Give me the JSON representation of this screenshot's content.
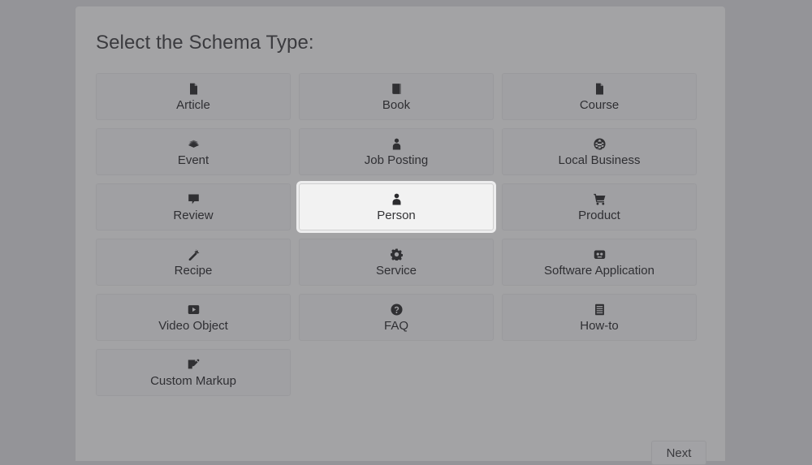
{
  "page": {
    "background_color": "#949498",
    "panel_color": "#a3a3a5"
  },
  "panel": {
    "title": "Select the Schema Type:"
  },
  "schema_types": {
    "selected": "Person",
    "items": [
      {
        "label": "Article",
        "icon": "file-icon",
        "selected": false
      },
      {
        "label": "Book",
        "icon": "book-icon",
        "selected": false
      },
      {
        "label": "Course",
        "icon": "file-icon",
        "selected": false
      },
      {
        "label": "Event",
        "icon": "ticket-stack-icon",
        "selected": false
      },
      {
        "label": "Job Posting",
        "icon": "user-tie-icon",
        "selected": false
      },
      {
        "label": "Local Business",
        "icon": "globe-icon",
        "selected": false
      },
      {
        "label": "Review",
        "icon": "comment-icon",
        "selected": false
      },
      {
        "label": "Person",
        "icon": "user-icon",
        "selected": true
      },
      {
        "label": "Product",
        "icon": "shopping-cart-icon",
        "selected": false
      },
      {
        "label": "Recipe",
        "icon": "carrot-icon",
        "selected": false
      },
      {
        "label": "Service",
        "icon": "gear-icon",
        "selected": false
      },
      {
        "label": "Software Application",
        "icon": "app-window-icon",
        "selected": false
      },
      {
        "label": "Video Object",
        "icon": "play-square-icon",
        "selected": false
      },
      {
        "label": "FAQ",
        "icon": "question-circle-icon",
        "selected": false
      },
      {
        "label": "How-to",
        "icon": "list-lines-icon",
        "selected": false
      },
      {
        "label": "Custom Markup",
        "icon": "pen-square-icon",
        "selected": false
      }
    ]
  },
  "footer": {
    "next_label": "Next"
  }
}
